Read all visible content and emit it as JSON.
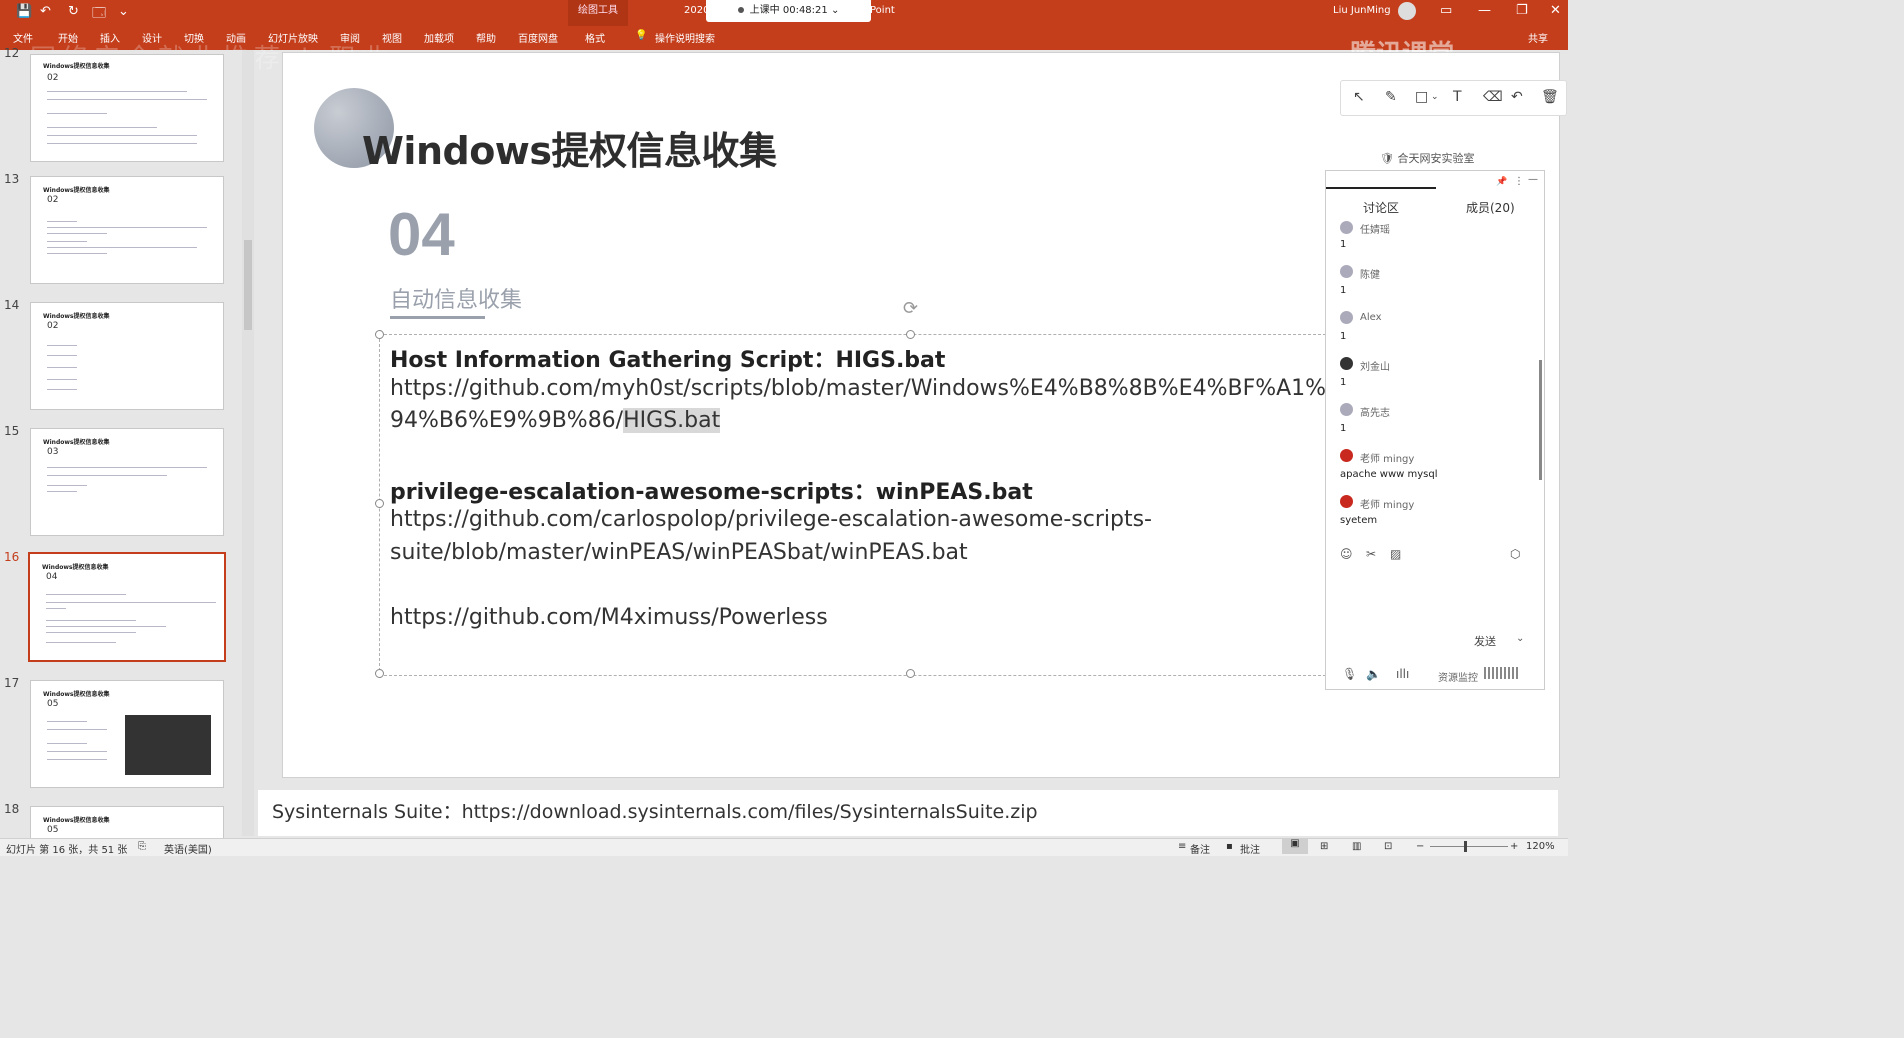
{
  "titlebar": {
    "quick_access": [
      "💾",
      "↶",
      "↻",
      "🗔",
      "⌄"
    ],
    "context_tab": "绘图工具",
    "year_fragment": "2020",
    "recording_status": "上课中 00:48:21",
    "app_fragment": "Point",
    "user": "Liu JunMing",
    "window_controls": [
      "▭",
      "—",
      "❐",
      "✕"
    ]
  },
  "ribbon": {
    "tabs": [
      "文件",
      "开始",
      "插入",
      "设计",
      "切换",
      "动画",
      "幻灯片放映",
      "审阅",
      "视图",
      "加载项",
      "帮助",
      "百度网盘",
      "格式"
    ],
    "search_hint": "操作说明搜索",
    "share": "共享"
  },
  "watermark_text": "网络安全就业推荐 | 职业",
  "tencent_logo": "腾讯课堂",
  "thumbnails": [
    {
      "num": "12",
      "title": "Windows提权信息收集",
      "section": "02"
    },
    {
      "num": "13",
      "title": "Windows提权信息收集",
      "section": "02"
    },
    {
      "num": "14",
      "title": "Windows提权信息收集",
      "section": "02"
    },
    {
      "num": "15",
      "title": "Windows提权信息收集",
      "section": "03"
    },
    {
      "num": "16",
      "title": "Windows提权信息收集",
      "section": "04"
    },
    {
      "num": "17",
      "title": "Windows提权信息收集",
      "section": "05"
    },
    {
      "num": "18",
      "title": "Windows提权信息收集",
      "section": "05"
    }
  ],
  "slide": {
    "title": "Windows提权信息收集",
    "section_number": "04",
    "section_subtitle": "自动信息收集",
    "line1": "Host Information Gathering Script：HIGS.bat",
    "line2": "https://github.com/myh0st/scripts/blob/master/Windows%E4%B8%8B%E4%BF%A1%E6%81%AF%E6%",
    "line3a": "94%B6%E9%9B%86/",
    "line3b": "HIGS.bat",
    "line4": "privilege-escalation-awesome-scripts：winPEAS.bat",
    "line5": "https://github.com/carlospolop/privilege-escalation-awesome-scripts-",
    "line6": "suite/blob/master/winPEAS/winPEASbat/winPEAS.bat",
    "line7": "https://github.com/M4ximuss/Powerless"
  },
  "notes": "Sysinternals Suite：https://download.sysinternals.com/files/SysinternalsSuite.zip",
  "statusbar": {
    "slide_count": "幻灯片 第 16 张，共 51 张",
    "language": "英语(美国)",
    "notes_btn": "备注",
    "comments_btn": "批注",
    "zoom": "120%"
  },
  "lab_logo": "合天网安实验室",
  "chat": {
    "tab_discuss": "讨论区",
    "tab_members": "成员(20)",
    "messages": [
      {
        "name": "任婧瑶",
        "text": "1",
        "teacher": false
      },
      {
        "name": "陈健",
        "text": "1",
        "teacher": false
      },
      {
        "name": "Alex",
        "text": "1",
        "teacher": false
      },
      {
        "name": "刘金山",
        "text": "1",
        "teacher": false
      },
      {
        "name": "高先志",
        "text": "1",
        "teacher": false
      },
      {
        "name": "老师 mingy",
        "text": "apache www mysql",
        "teacher": true
      },
      {
        "name": "老师 mingy",
        "text": "syetem",
        "teacher": true
      }
    ],
    "send_label": "发送",
    "resource_monitor": "资源监控"
  },
  "colors": {
    "accent": "#c43e1c",
    "section_gray": "#9aa1ac",
    "teacher_avatar": "#c8281e"
  }
}
